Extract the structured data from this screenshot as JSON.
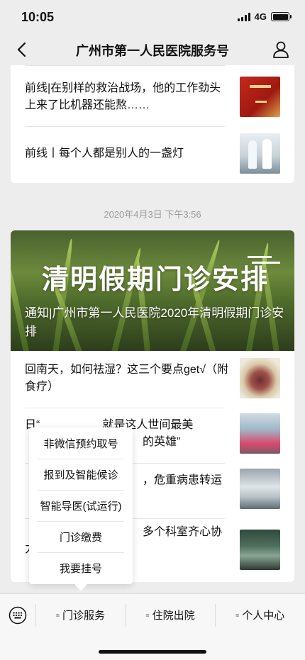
{
  "status": {
    "time": "10:05",
    "network": "4G"
  },
  "nav": {
    "title": "广州市第一人民医院服务号",
    "back_icon": "chevron-left-icon",
    "profile_icon": "person-icon"
  },
  "card1": {
    "articles": [
      {
        "title": "前线|在别样的救治战场，他的工作劲头上来了比机器还能熬……"
      },
      {
        "title": "前线丨每个人都是别人的一盏灯"
      }
    ]
  },
  "date_stamp": "2020年4月3日 下午3:56",
  "card2": {
    "hero": {
      "banner_text": "清明假期门诊安排",
      "caption": "通知|广州市第一人民医院2020年清明假期门诊安排"
    },
    "articles": [
      {
        "title": "回南天，如何祛湿？这三个要点get√（附食疗）"
      },
      {
        "title": "日“"
      },
      {
        "title": "就是这人世间最美"
      },
      {
        "title": "的英雄”"
      },
      {
        "title": "，危重病患转运"
      },
      {
        "title": "多个科室齐心协力"
      }
    ]
  },
  "popup_menu": {
    "items": [
      "非微信预约取号",
      "报到及智能候诊",
      "智能导医(试运行)",
      "门诊缴费",
      "我要挂号"
    ]
  },
  "menubar": {
    "keyboard_icon": "keyboard-icon",
    "items": [
      "门诊服务",
      "住院出院",
      "个人中心"
    ]
  },
  "colors": {
    "background": "#ededed",
    "card": "#ffffff",
    "menubar": "#f7f7f7"
  }
}
